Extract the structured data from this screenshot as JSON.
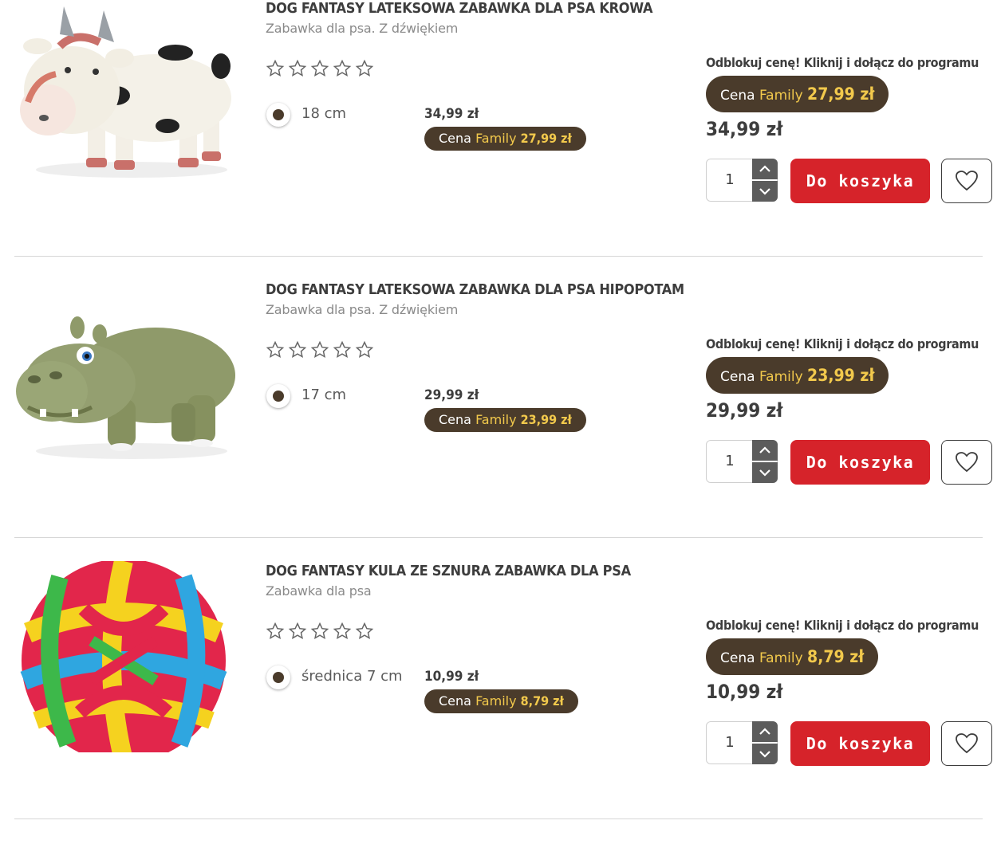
{
  "products": [
    {
      "name": "cow",
      "title": "DOG FANTASY LATEKSOWA ZABAWKA DLA PSA KROWA",
      "subtitle": "Zabawka dla psa. Z dźwiękiem",
      "rating": 0,
      "variant": {
        "label": "18 cm",
        "price": "34,99 zł",
        "family_prefix": "Cena",
        "family_word": "Family",
        "family_price": "27,99 zł"
      },
      "promo": "Odblokuj cenę! Kliknij i dołącz do programu",
      "family_prefix": "Cena",
      "family_word": "Family",
      "family_price": "27,99 zł",
      "price": "34,99 zł",
      "quantity": "1",
      "cart_label": "Do koszyka",
      "icons": {
        "star": "star-outline-icon",
        "up": "chevron-up-icon",
        "down": "chevron-down-icon",
        "fav": "heart-icon"
      }
    },
    {
      "name": "hippo",
      "title": "DOG FANTASY LATEKSOWA ZABAWKA DLA PSA HIPOPOTAM",
      "subtitle": "Zabawka dla psa. Z dźwiękiem",
      "rating": 0,
      "variant": {
        "label": "17 cm",
        "price": "29,99 zł",
        "family_prefix": "Cena",
        "family_word": "Family",
        "family_price": "23,99 zł"
      },
      "promo": "Odblokuj cenę! Kliknij i dołącz do programu",
      "family_prefix": "Cena",
      "family_word": "Family",
      "family_price": "23,99 zł",
      "price": "29,99 zł",
      "quantity": "1",
      "cart_label": "Do koszyka",
      "icons": {
        "star": "star-outline-icon",
        "up": "chevron-up-icon",
        "down": "chevron-down-icon",
        "fav": "heart-icon"
      }
    },
    {
      "name": "rope-ball",
      "title": "DOG FANTASY KULA ZE SZNURA ZABAWKA DLA PSA",
      "subtitle": "Zabawka dla psa",
      "rating": 0,
      "variant": {
        "label": "średnica 7 cm",
        "price": "10,99 zł",
        "family_prefix": "Cena",
        "family_word": "Family",
        "family_price": "8,79 zł"
      },
      "promo": "Odblokuj cenę! Kliknij i dołącz do programu",
      "family_prefix": "Cena",
      "family_word": "Family",
      "family_price": "8,79 zł",
      "price": "10,99 zł",
      "quantity": "1",
      "cart_label": "Do koszyka",
      "icons": {
        "star": "star-outline-icon",
        "up": "chevron-up-icon",
        "down": "chevron-down-icon",
        "fav": "heart-icon"
      }
    }
  ],
  "colors": {
    "brand_brown": "#4a3b2b",
    "family_yellow": "#f2c94c",
    "cart_red": "#d6232a"
  }
}
